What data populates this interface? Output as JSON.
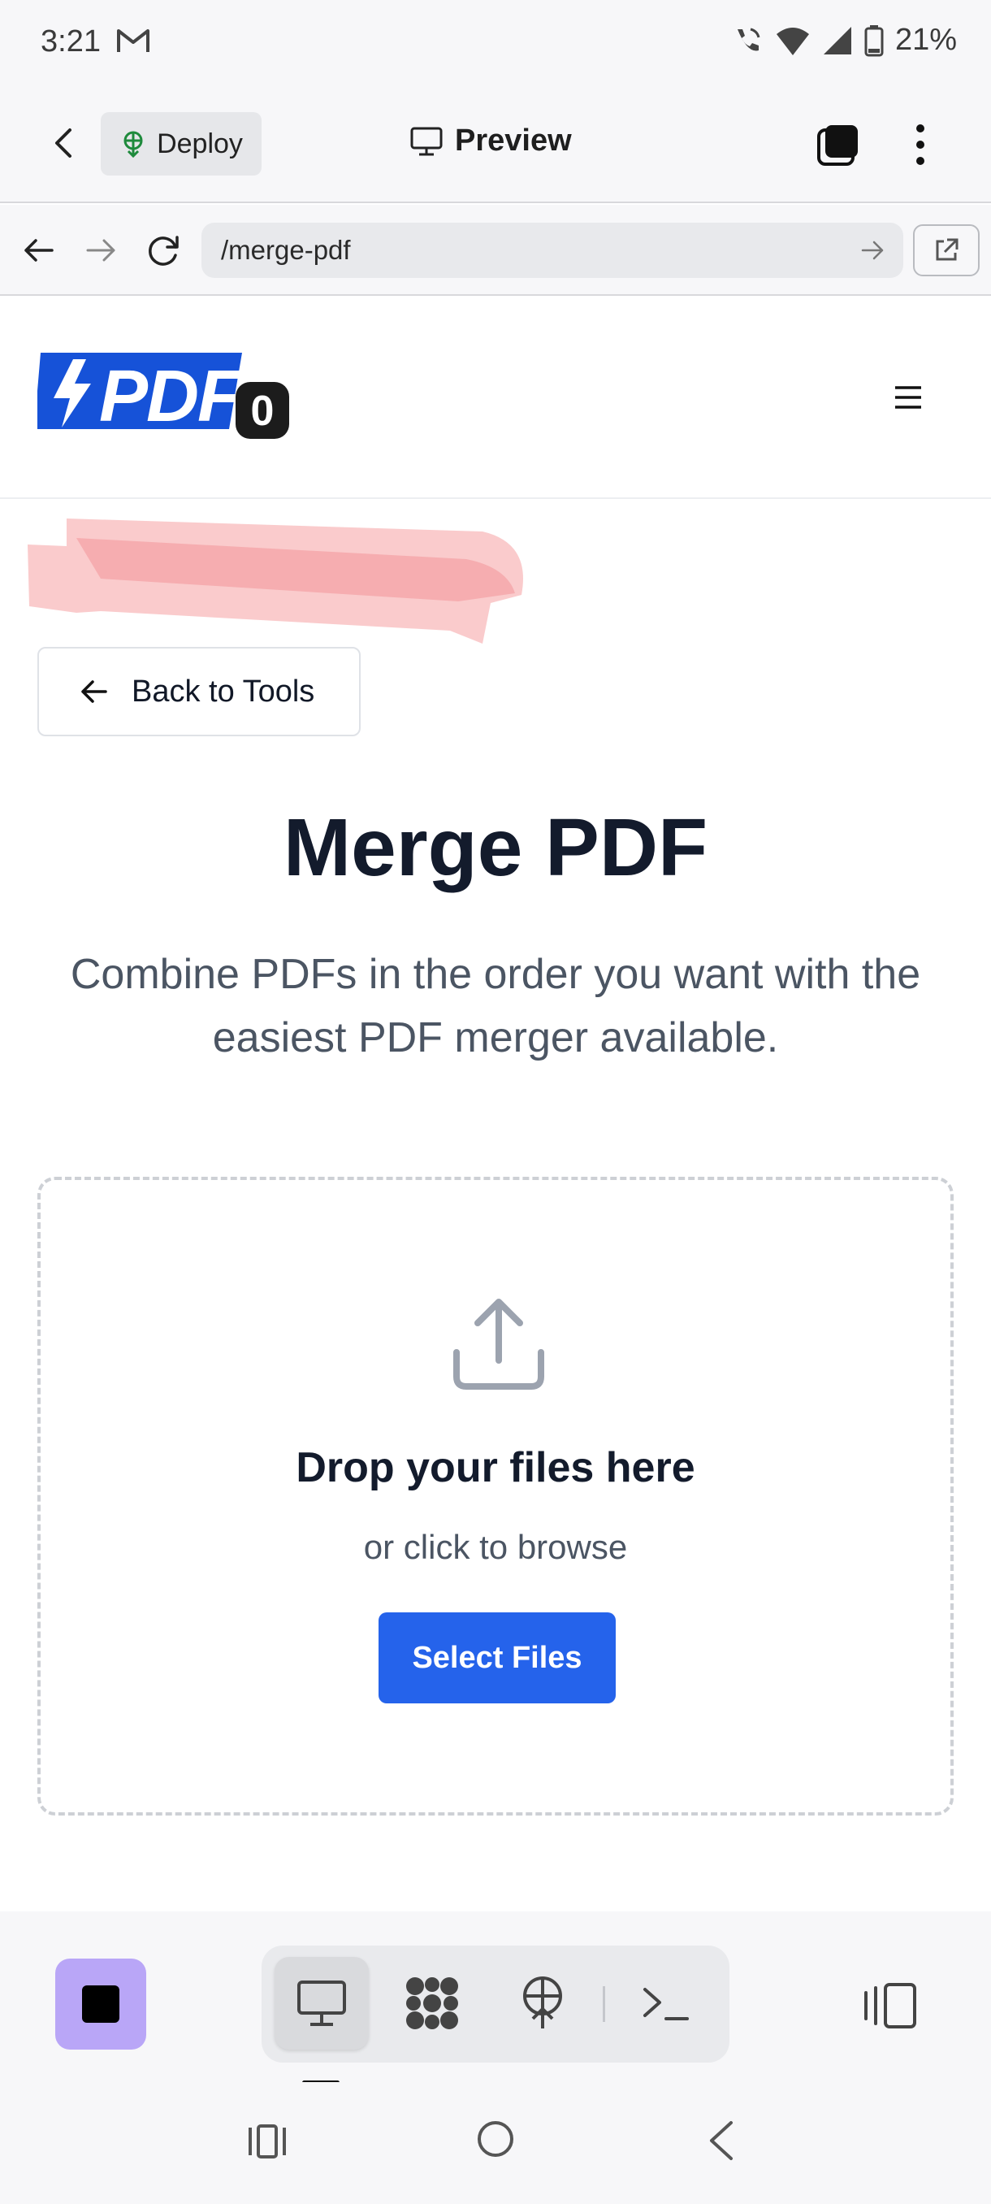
{
  "status_bar": {
    "time": "3:21",
    "battery": "21%",
    "icons": [
      "gmail-icon",
      "wifi-calling-icon",
      "wifi-icon",
      "signal-icon",
      "battery-icon"
    ]
  },
  "app_bar": {
    "deploy_label": "Deploy",
    "preview_label": "Preview"
  },
  "address_bar": {
    "url": "/merge-pdf"
  },
  "site_header": {
    "logo_text": "PDF",
    "logo_badge": "0"
  },
  "page": {
    "back_label": "Back to Tools",
    "title": "Merge PDF",
    "subtitle": "Combine PDFs in the order you want with the easiest PDF merger available."
  },
  "dropzone": {
    "title": "Drop your files here",
    "subtitle": "or click to browse",
    "button_label": "Select Files"
  },
  "colors": {
    "primary": "#2563eb",
    "logo_blue": "#1652d8",
    "stop_button": "#b9a6f7",
    "scribble": "#f7a8aa"
  }
}
